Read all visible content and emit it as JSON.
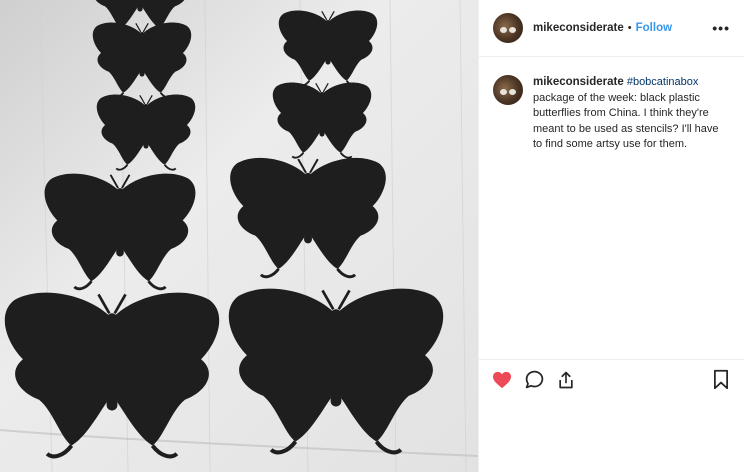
{
  "post": {
    "username": "mikeconsiderate",
    "separator": "•",
    "follow_label": "Follow",
    "more_label": "•••",
    "caption": {
      "username": "mikeconsiderate",
      "hashtag": "#bobcatinabox",
      "text": "package of the week: black plastic butterflies from China. I think they're meant to be used as stencils? I'll have to find some artsy use for them."
    },
    "image": {
      "subject": "black plastic butterfly stencils on wood",
      "filter": "black-and-white"
    },
    "actions": {
      "like": "heart-icon",
      "comment": "comment-icon",
      "share": "share-icon",
      "save": "bookmark-icon"
    },
    "colors": {
      "link": "#3897f0",
      "hashtag": "#003569",
      "like": "#ed4956",
      "text": "#262626",
      "butterfly": "#1e1e1e"
    }
  }
}
